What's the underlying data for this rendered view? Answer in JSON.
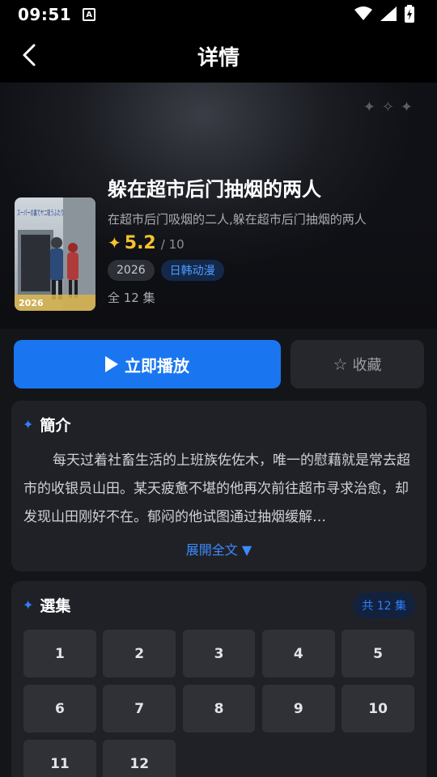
{
  "status_bar": {
    "time": "09:51",
    "indicator": "A"
  },
  "app_bar": {
    "title": "详情",
    "back_icon": "chevron-left-icon"
  },
  "show": {
    "title": "躲在超市后门抽烟的两人",
    "alt_title": "在超市后门吸烟的二人,躲在超市后门抽烟的两人",
    "rating": "5.2",
    "rating_max": "/ 10",
    "year": "2026",
    "genre": "日韩动漫",
    "episodes_label": "全 12 集",
    "poster": {
      "title_text": "スーパーの裏でヤニ吸うふたり",
      "stamp": "2026"
    }
  },
  "actions": {
    "play_label": "立即播放",
    "favorite_label": "收藏"
  },
  "synopsis": {
    "heading": "簡介",
    "text": "每天过着社畜生活的上班族佐佐木，唯一的慰藉就是常去超市的收银员山田。某天疲惫不堪的他再次前往超市寻求治愈，却发现山田刚好不在。郁闷的他试图通过抽烟缓解…",
    "expand_label": "展開全文 ▼"
  },
  "episodes": {
    "heading": "選集",
    "total_label": "共 12 集",
    "items": [
      "1",
      "2",
      "3",
      "4",
      "5",
      "6",
      "7",
      "8",
      "9",
      "10",
      "11",
      "12"
    ]
  },
  "colors": {
    "accent": "#1976f0",
    "rating": "#f5c330",
    "background": "#141519",
    "card": "#202127"
  }
}
